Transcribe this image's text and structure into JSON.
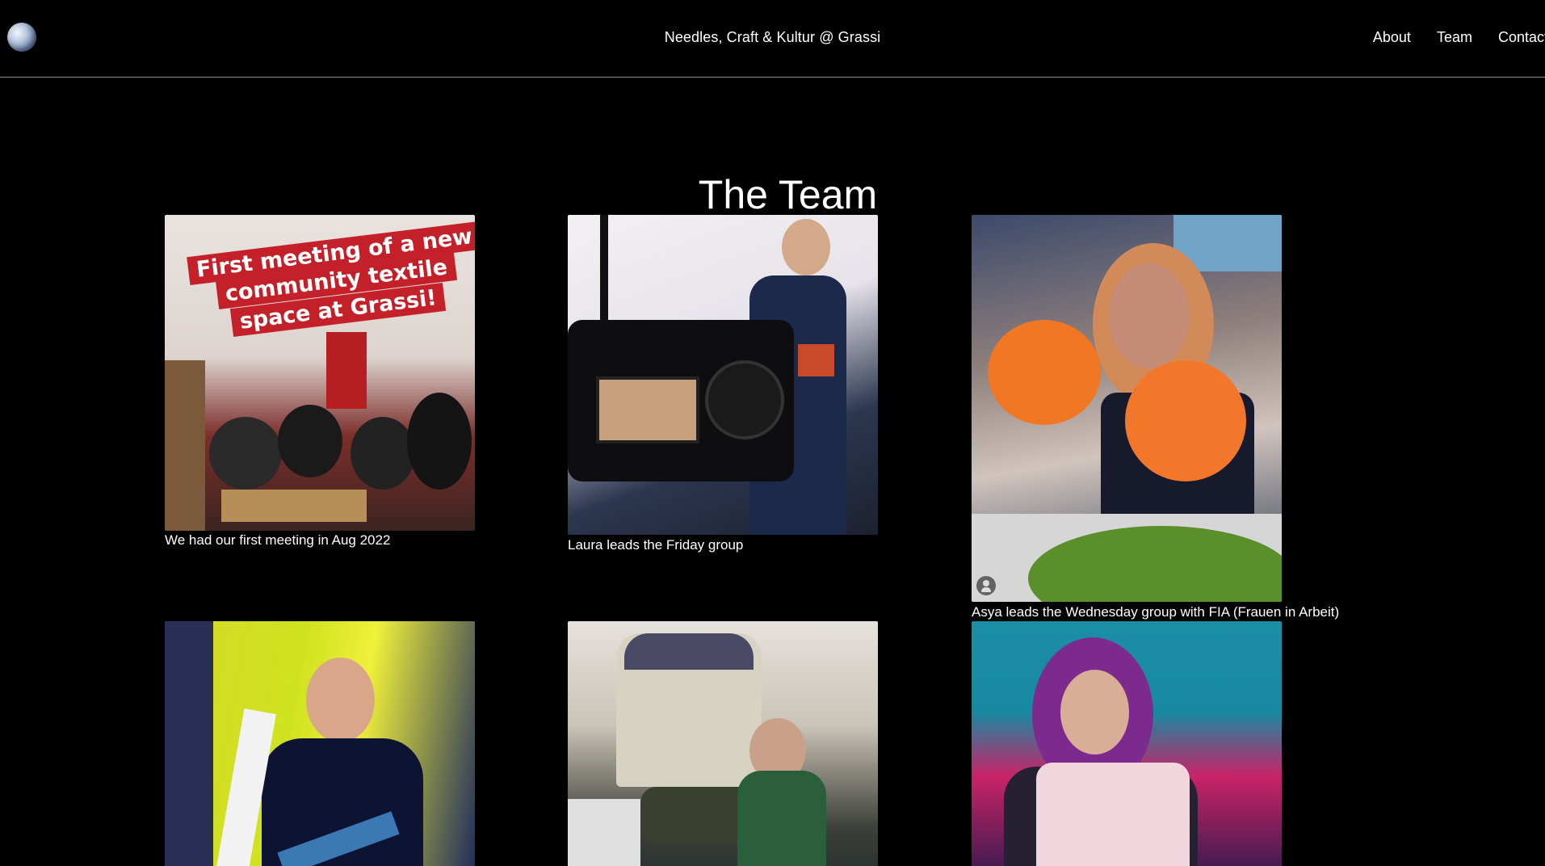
{
  "header": {
    "logo_icon": "globe-icon",
    "site_title": "Needles, Craft & Kultur @ Grassi",
    "nav": [
      {
        "label": "About"
      },
      {
        "label": "Team"
      },
      {
        "label": "Contact"
      }
    ]
  },
  "main": {
    "title": "The Team",
    "cards": [
      {
        "caption": "We had our first meeting in Aug 2022",
        "photo_text": [
          "First meeting of a new",
          "community textile",
          "space at Grassi!"
        ]
      },
      {
        "caption": "Laura leads the Friday group"
      },
      {
        "caption": "Asya leads the Wednesday group with FIA (Frauen in Arbeit)",
        "photo_icon": "user-icon"
      },
      {
        "caption": ""
      },
      {
        "caption": ""
      },
      {
        "caption": ""
      }
    ]
  }
}
